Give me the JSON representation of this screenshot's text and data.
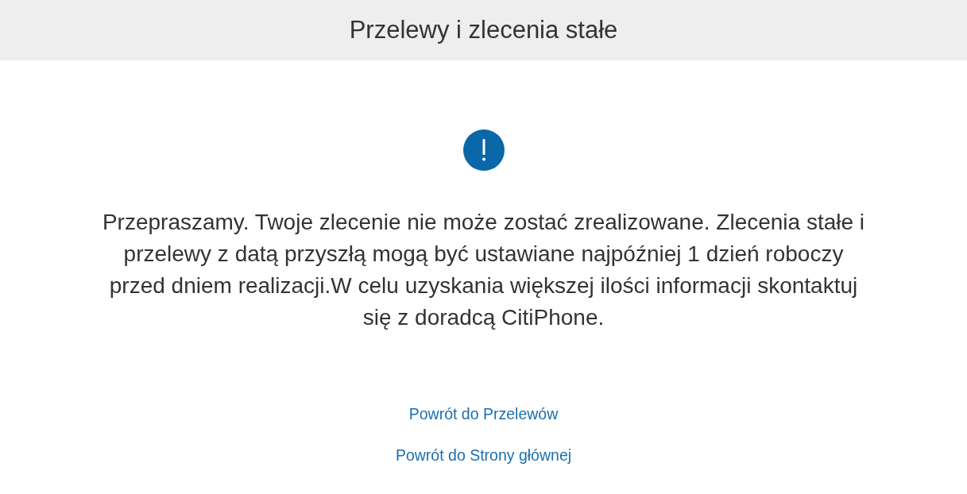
{
  "header": {
    "title": "Przelewy i zlecenia stałe"
  },
  "message": "Przepraszamy. Twoje zlecenie nie może zostać zrealizowane. Zlecenia stałe i przelewy z datą przyszłą mogą być ustawiane najpóźniej 1 dzień roboczy przed dniem realizacji.W celu uzyskania większej ilości informacji skontaktuj się z doradcą CitiPhone.",
  "links": [
    {
      "label": "Powrót do Przelewów"
    },
    {
      "label": "Powrót do Strony głównej"
    }
  ]
}
